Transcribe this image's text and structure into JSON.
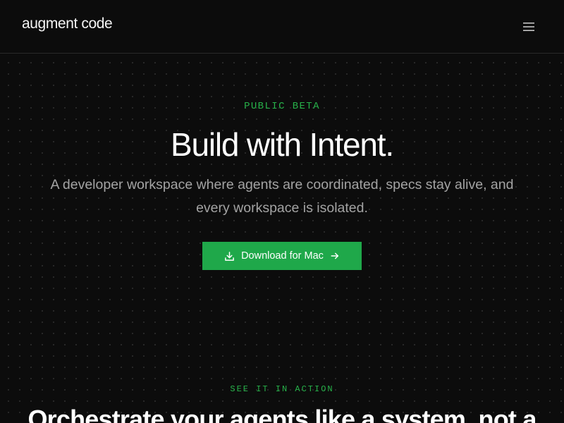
{
  "header": {
    "logo_text": "augment code",
    "menu_icon": "hamburger-menu-icon"
  },
  "hero": {
    "eyebrow": "PUBLIC BETA",
    "title": "Build with Intent.",
    "subtitle": "A developer workspace where agents are coordinated, specs stay alive, and every workspace is isolated.",
    "cta": {
      "label": "Download for Mac",
      "leading_icon": "download-icon",
      "trailing_icon": "arrow-right-icon"
    }
  },
  "section": {
    "eyebrow": "SEE IT IN ACTION",
    "title": "Orchestrate your agents like a system, not a"
  },
  "colors": {
    "background": "#0c0c0c",
    "accent_green": "#1fa84a",
    "eyebrow_green": "#27b24a",
    "subtitle_gray": "#a3a3a3",
    "divider": "#2a2a2a"
  }
}
